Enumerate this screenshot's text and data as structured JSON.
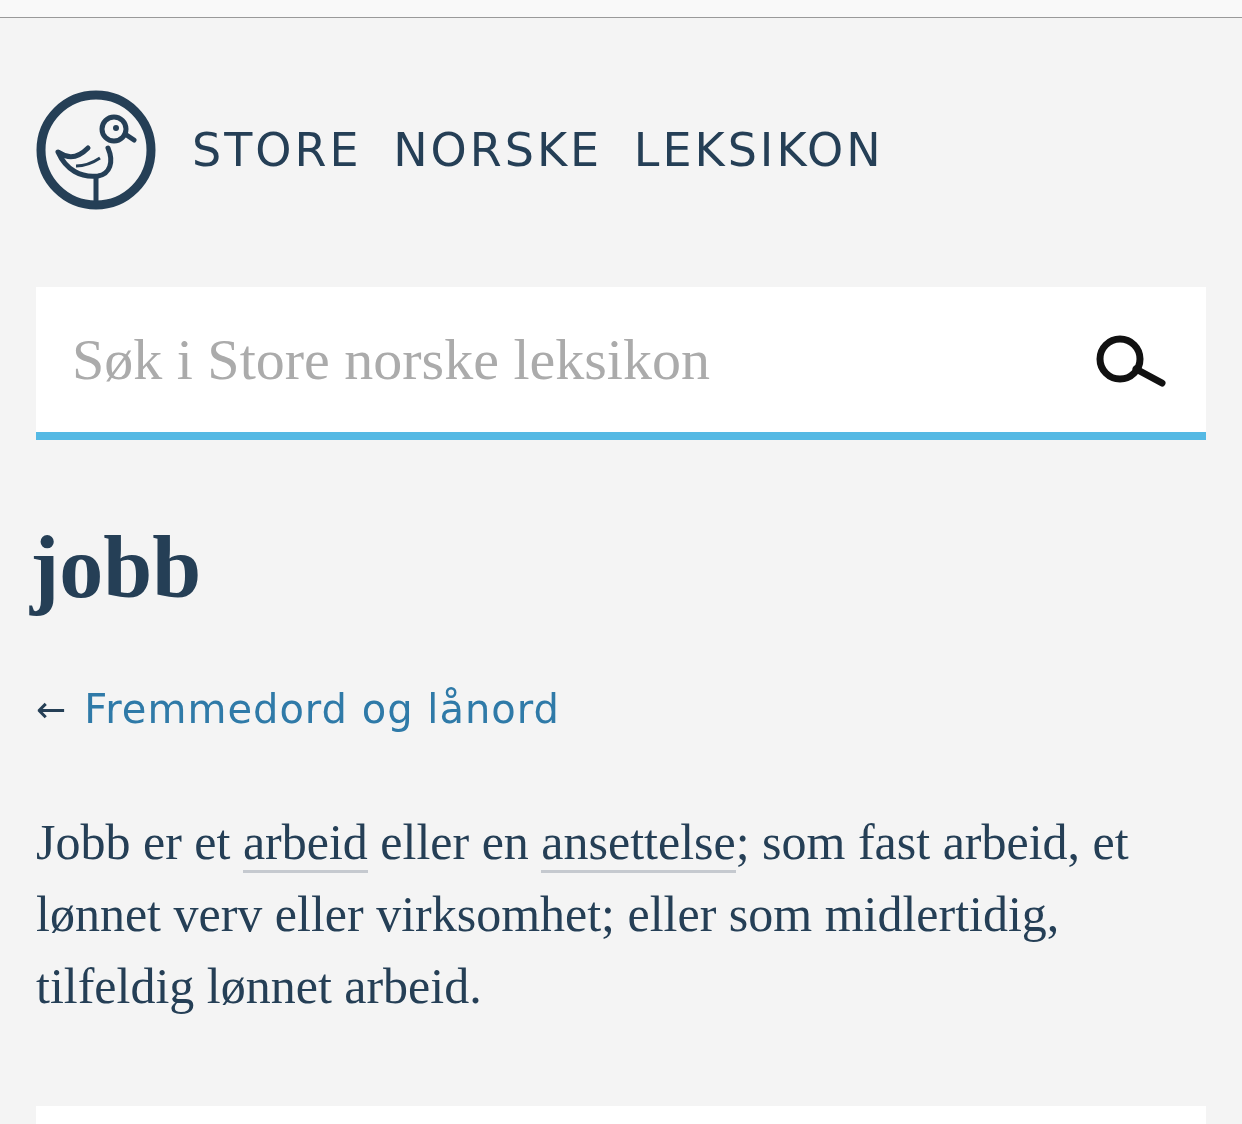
{
  "header": {
    "site_title": "STORE NORSKE LEKSIKON"
  },
  "search": {
    "placeholder": "Søk i Store norske leksikon"
  },
  "article": {
    "title": "jobb",
    "breadcrumb": {
      "arrow": "←",
      "label": "Fremmedord og lånord"
    },
    "paragraph": [
      {
        "kind": "text",
        "text": "Jobb er et "
      },
      {
        "kind": "link",
        "text": "arbeid"
      },
      {
        "kind": "text",
        "text": " eller en "
      },
      {
        "kind": "link",
        "text": "ansettelse"
      },
      {
        "kind": "text",
        "text": "; som fast arbeid, et lønnet verv eller virksomhet; eller som midlertidig, tilfeldig lønnet arbeid."
      }
    ]
  }
}
